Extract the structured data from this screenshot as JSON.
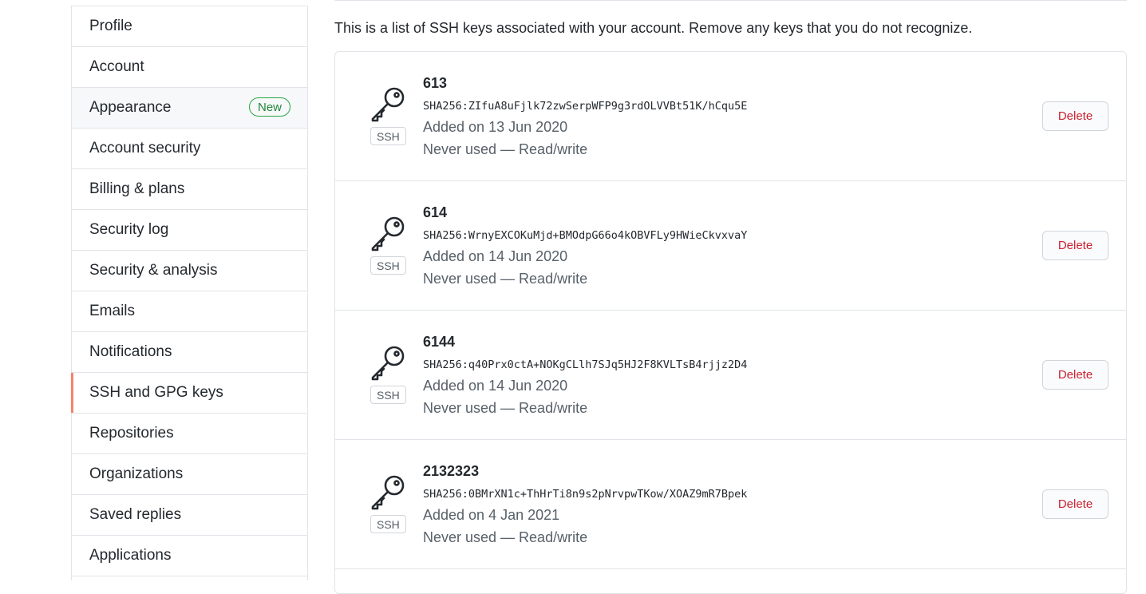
{
  "sidebar": {
    "items": [
      {
        "label": "Profile"
      },
      {
        "label": "Account"
      },
      {
        "label": "Appearance",
        "badge": "New"
      },
      {
        "label": "Account security"
      },
      {
        "label": "Billing & plans"
      },
      {
        "label": "Security log"
      },
      {
        "label": "Security & analysis"
      },
      {
        "label": "Emails"
      },
      {
        "label": "Notifications"
      },
      {
        "label": "SSH and GPG keys",
        "selected": true
      },
      {
        "label": "Repositories"
      },
      {
        "label": "Organizations"
      },
      {
        "label": "Saved replies"
      },
      {
        "label": "Applications"
      }
    ]
  },
  "main": {
    "intro": "This is a list of SSH keys associated with your account. Remove any keys that you do not recognize.",
    "keys": [
      {
        "title": "613",
        "fingerprint": "SHA256:ZIfuA8uFjlk72zwSerpWFP9g3rdOLVVBt51K/hCqu5E",
        "added": "Added on 13 Jun 2020",
        "usage": "Never used — Read/write",
        "type_label": "SSH",
        "delete_label": "Delete"
      },
      {
        "title": "614",
        "fingerprint": "SHA256:WrnyEXCOKuMjd+BMOdpG66o4kOBVFLy9HWieCkvxvaY",
        "added": "Added on 14 Jun 2020",
        "usage": "Never used — Read/write",
        "type_label": "SSH",
        "delete_label": "Delete"
      },
      {
        "title": "6144",
        "fingerprint": "SHA256:q40Prx0ctA+NOKgCLlh7SJq5HJ2F8KVLTsB4rjjz2D4",
        "added": "Added on 14 Jun 2020",
        "usage": "Never used — Read/write",
        "type_label": "SSH",
        "delete_label": "Delete"
      },
      {
        "title": "2132323",
        "fingerprint": "SHA256:0BMrXN1c+ThHrTi8n9s2pNrvpwTKow/XOAZ9mR7Bpek",
        "added": "Added on 4 Jan 2021",
        "usage": "Never used — Read/write",
        "type_label": "SSH",
        "delete_label": "Delete"
      }
    ]
  },
  "colors": {
    "selected_accent": "#f9826c",
    "new_badge": "#28a745",
    "delete_text": "#cb2431"
  },
  "icons": {
    "key": "key-icon"
  }
}
